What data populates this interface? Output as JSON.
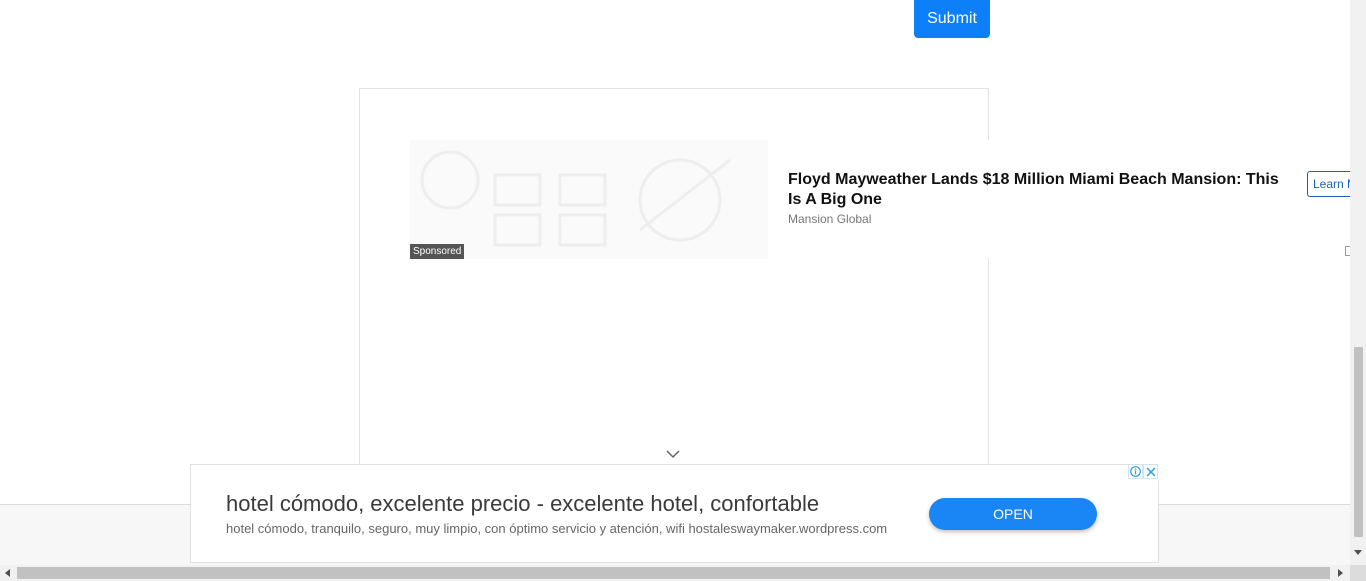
{
  "form": {
    "submit_label": "Submit"
  },
  "native_ad": {
    "sponsored_label": "Sponsored",
    "headline": "Floyd Mayweather Lands $18 Million Miami Beach Mansion: This Is A Big One",
    "source": "Mansion Global",
    "cta_label": "Learn More"
  },
  "banner_ad": {
    "title": "hotel cómodo, excelente precio - excelente hotel, confortable",
    "description": "hotel cómodo, tranquilo, seguro, muy limpio, con óptimo servicio y atención, wifi hostaleswaymaker.wordpress.com",
    "open_label": "OPEN",
    "info_icon": "info-icon",
    "close_icon": "close-icon"
  },
  "colors": {
    "accent": "#0d7ff9",
    "open_button": "#1a86f5",
    "cta_border": "#1e5fb3"
  }
}
